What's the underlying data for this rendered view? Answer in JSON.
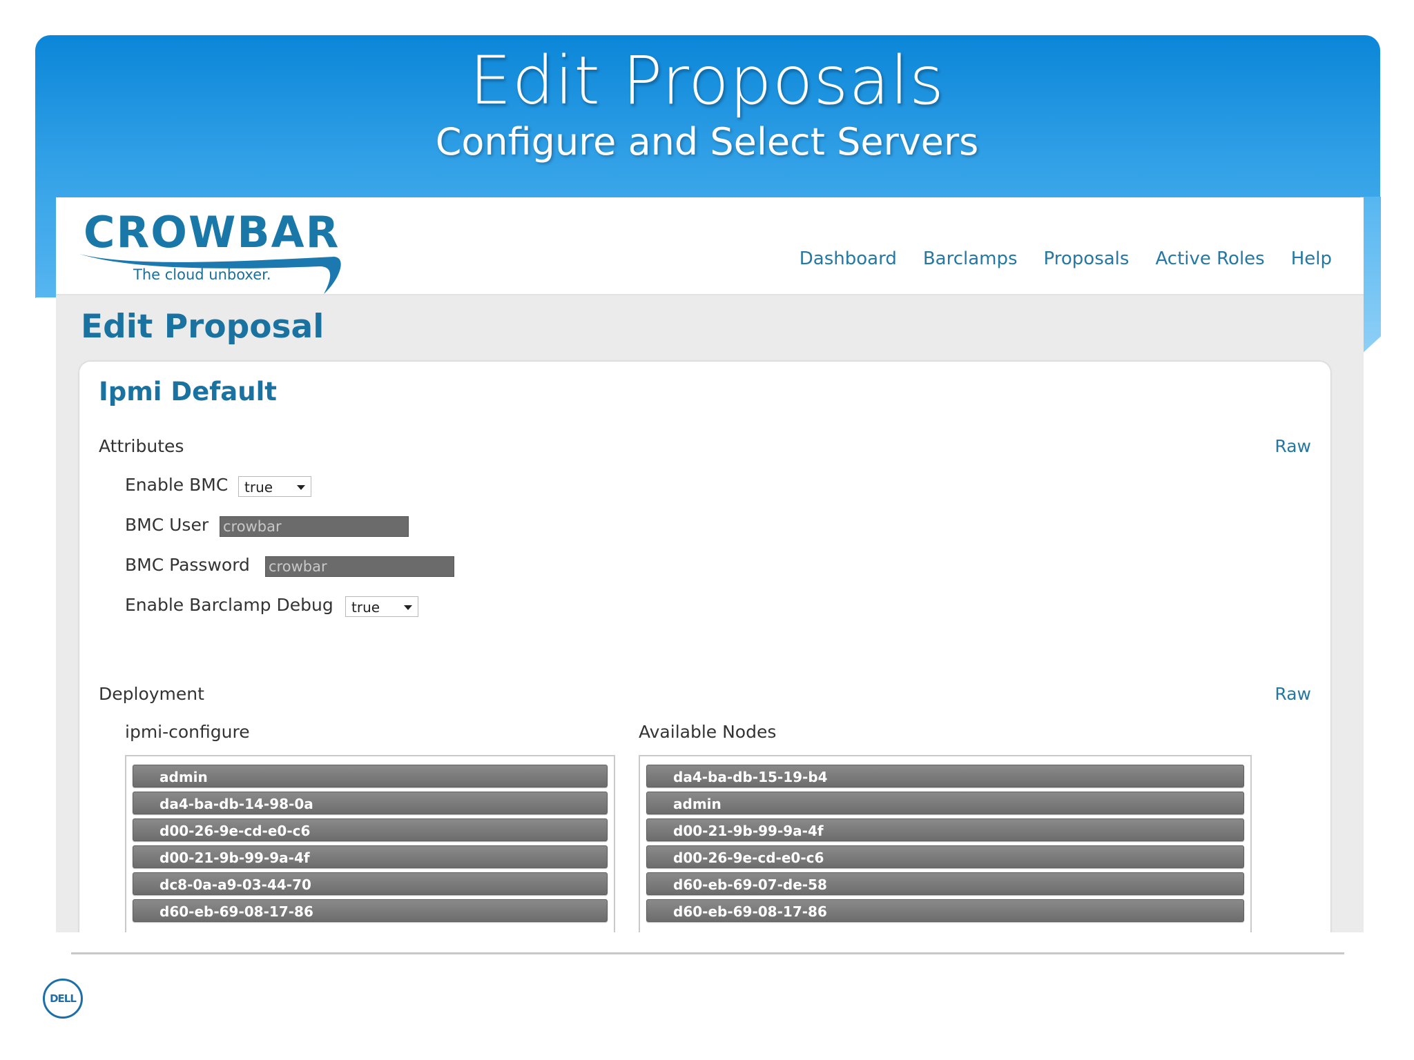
{
  "slide": {
    "title": "Edit Proposals",
    "subtitle": "Configure and Select Servers"
  },
  "app": {
    "logo": {
      "word": "CROWBAR",
      "tagline": "The cloud unboxer."
    },
    "nav": [
      "Dashboard",
      "Barclamps",
      "Proposals",
      "Active Roles",
      "Help"
    ]
  },
  "page": {
    "title": "Edit Proposal",
    "panel_title": "Ipmi Default",
    "attributes": {
      "label": "Attributes",
      "raw_label": "Raw",
      "enable_bmc": {
        "label": "Enable BMC",
        "value": "true"
      },
      "bmc_user": {
        "label": "BMC User",
        "value": "crowbar"
      },
      "bmc_password": {
        "label": "BMC Password",
        "value": "crowbar"
      },
      "enable_debug": {
        "label": "Enable Barclamp Debug",
        "value": "true"
      }
    },
    "deployment": {
      "label": "Deployment",
      "raw_label": "Raw",
      "role_column": {
        "label": "ipmi-configure",
        "nodes": [
          "admin",
          "da4-ba-db-14-98-0a",
          "d00-26-9e-cd-e0-c6",
          "d00-21-9b-99-9a-4f",
          "dc8-0a-a9-03-44-70",
          "d60-eb-69-08-17-86"
        ]
      },
      "available_column": {
        "label": "Available Nodes",
        "nodes": [
          "da4-ba-db-15-19-b4",
          "admin",
          "d00-21-9b-99-9a-4f",
          "d00-26-9e-cd-e0-c6",
          "d60-eb-69-07-de-58",
          "d60-eb-69-08-17-86"
        ]
      }
    }
  },
  "footer": {
    "logo_text": "DELL"
  },
  "colors": {
    "banner": "#1f95e0",
    "link": "#2478a3",
    "heading": "#19729f",
    "node_bg": "#7a7a7a"
  }
}
